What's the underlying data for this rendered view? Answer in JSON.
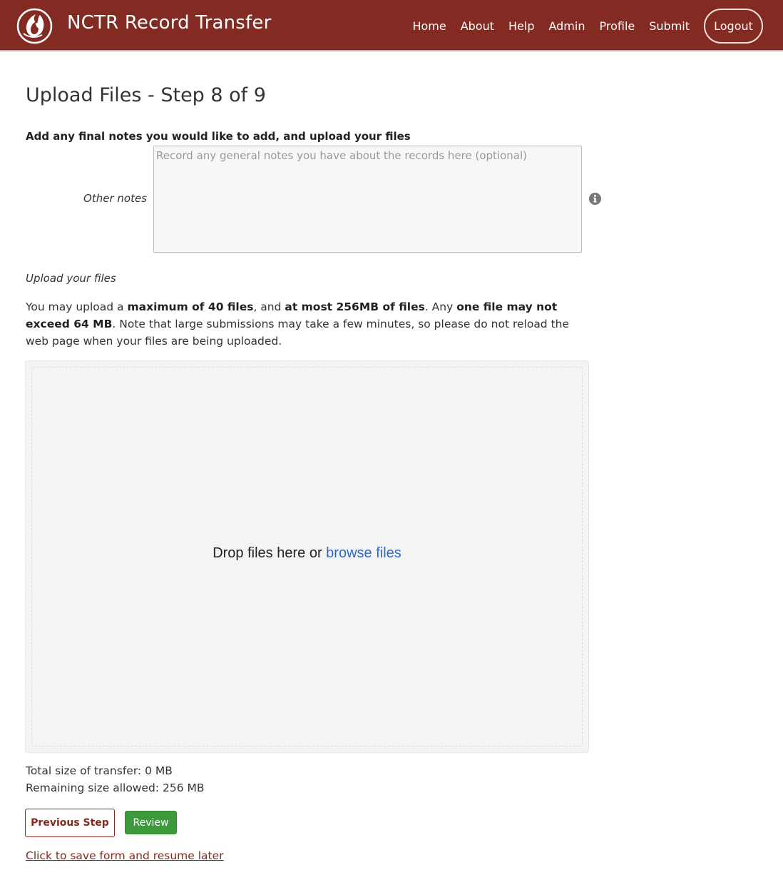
{
  "header": {
    "brand_title": "NCTR Record Transfer",
    "nav": [
      "Home",
      "About",
      "Help",
      "Admin",
      "Profile",
      "Submit"
    ],
    "logout_label": "Logout",
    "logo_icon": "flame-logo-icon"
  },
  "main": {
    "title": "Upload Files - Step 8 of 9",
    "section_heading": "Add any final notes you would like to add, and upload your files",
    "notes": {
      "label": "Other notes",
      "placeholder": "Record any general notes you have about the records here (optional)",
      "value": "",
      "info_icon": "info-icon"
    },
    "upload": {
      "label": "Upload your files",
      "info": {
        "p1": "You may upload a ",
        "b1": "maximum of 40 files",
        "p2": ", and ",
        "b2": "at most 256MB of files",
        "p3": ". Any ",
        "b3": "one file may not exceed 64 MB",
        "p4": ". Note that large submissions may take a few minutes, so please do not reload the web page when your files are being uploaded."
      },
      "drop_text": "Drop files here or ",
      "browse_label": "browse files"
    },
    "total_size": "Total size of transfer: 0 MB",
    "remaining_size": "Remaining size allowed: 256 MB",
    "previous_label": "Previous Step",
    "review_label": "Review",
    "save_label": "Click to save form and resume later"
  },
  "colors": {
    "brand": "#832a22",
    "success": "#3d9a3a",
    "link": "#2d6bc7"
  }
}
